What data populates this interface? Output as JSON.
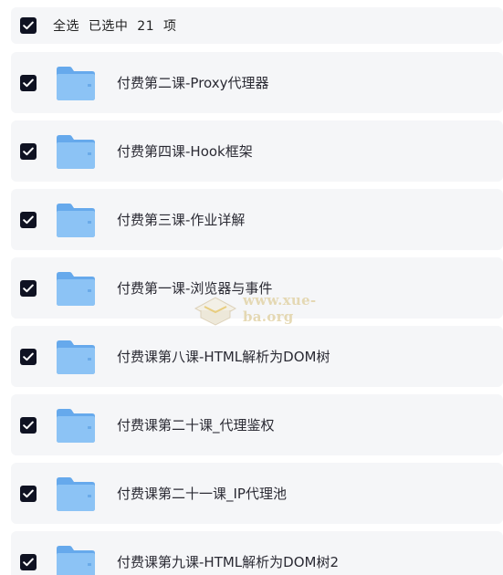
{
  "header": {
    "select_all_label": "全选  已选中  21  项",
    "checked": true
  },
  "items": [
    {
      "name": "付费第二课-Proxy代理器",
      "checked": true,
      "icon": "folder-icon"
    },
    {
      "name": "付费第四课-Hook框架",
      "checked": true,
      "icon": "folder-icon"
    },
    {
      "name": "付费第三课-作业详解",
      "checked": true,
      "icon": "folder-icon"
    },
    {
      "name": "付费第一课-浏览器与事件",
      "checked": true,
      "icon": "folder-icon"
    },
    {
      "name": "付费课第八课-HTML解析为DOM树",
      "checked": true,
      "icon": "folder-icon"
    },
    {
      "name": "付费课第二十课_代理鉴权",
      "checked": true,
      "icon": "folder-icon"
    },
    {
      "name": "付费课第二十一课_IP代理池",
      "checked": true,
      "icon": "folder-icon"
    },
    {
      "name": "付费课第九课-HTML解析为DOM树2",
      "checked": true,
      "icon": "folder-icon"
    }
  ],
  "watermark": {
    "text": "www.xue-ba.org"
  },
  "colors": {
    "checkbox": "#0f1222",
    "row_background": "#f5f6f8",
    "folder_blue": "#7cb9f1"
  }
}
